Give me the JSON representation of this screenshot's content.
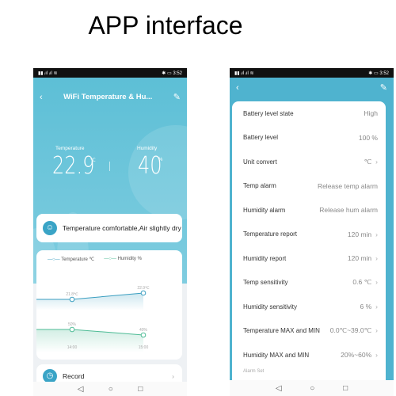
{
  "page_title": "APP interface",
  "status_bar": {
    "time": "3:52",
    "battery": "87"
  },
  "left": {
    "header_title": "WiFi Temperature & Hu...",
    "temperature_label": "Temperature",
    "temperature_value": "22.9",
    "temperature_unit": "℃",
    "humidity_label": "Humidity",
    "humidity_value": "40",
    "humidity_unit": "%",
    "comfort_text": "Temperature comfortable,Air slightly dry",
    "record_label": "Record"
  },
  "chart_data": {
    "type": "line",
    "x": [
      "14:00",
      "15:00"
    ],
    "series": [
      {
        "name": "Temperature ℃",
        "values": [
          21.8,
          22.9
        ],
        "labels": [
          "21.8℃",
          "22.9℃"
        ],
        "color": "#3a9ec0"
      },
      {
        "name": "Humidity %",
        "values": [
          50,
          40
        ],
        "labels": [
          "50%",
          "40%"
        ],
        "color": "#4dbb95"
      }
    ]
  },
  "right": {
    "rows": [
      {
        "label": "Battery level state",
        "value": "High",
        "chevron": false
      },
      {
        "label": "Battery level",
        "value": "100 %",
        "chevron": false
      },
      {
        "label": "Unit convert",
        "value": "℃",
        "chevron": true
      },
      {
        "label": "Temp alarm",
        "value": "Release temp alarm",
        "chevron": false
      },
      {
        "label": "Humidity alarm",
        "value": "Release hum alarm",
        "chevron": false
      },
      {
        "label": "Temperature report",
        "value": "120 min",
        "chevron": true
      },
      {
        "label": "Humidity report",
        "value": "120 min",
        "chevron": true
      },
      {
        "label": "Temp sensitivity",
        "value": "0.6 ℃",
        "chevron": true
      },
      {
        "label": "Humidity sensitivity",
        "value": "6 %",
        "chevron": true
      },
      {
        "label": "Temperature MAX and MIN",
        "value": "0.0℃~39.0℃",
        "chevron": true
      },
      {
        "label": "Humidity MAX and MIN",
        "value": "20%~60%",
        "chevron": true
      }
    ],
    "section": "Alarm Set"
  },
  "colors": {
    "accent": "#5dbfd6",
    "temp_line": "#3a9ec0",
    "hum_line": "#4dbb95"
  }
}
